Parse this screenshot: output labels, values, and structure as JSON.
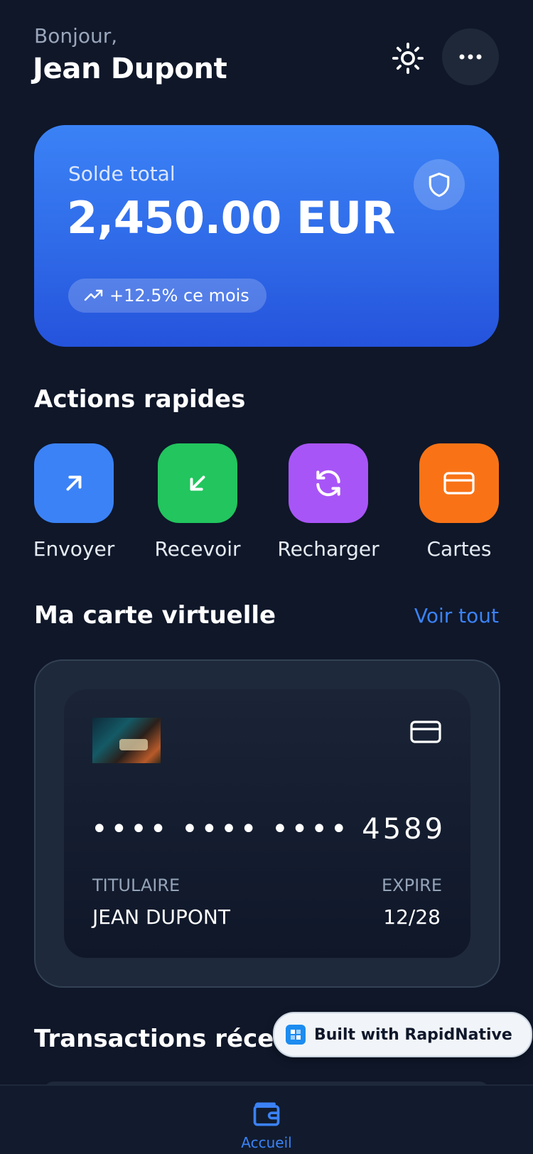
{
  "header": {
    "greeting": "Bonjour,",
    "user_name": "Jean Dupont"
  },
  "icons": {
    "theme": "sun-icon",
    "more": "more-horizontal-icon",
    "shield": "shield-icon",
    "trend": "trending-up-icon",
    "send": "arrow-up-right-icon",
    "receive": "arrow-down-left-icon",
    "reload": "refresh-icon",
    "cards": "credit-card-icon",
    "home": "wallet-icon"
  },
  "balance": {
    "label": "Solde total",
    "amount": "2,450.00 EUR",
    "trend": "+12.5% ce mois"
  },
  "quick_actions": {
    "title": "Actions rapides",
    "items": [
      {
        "label": "Envoyer",
        "color": "#3b82f6"
      },
      {
        "label": "Recevoir",
        "color": "#22c55e"
      },
      {
        "label": "Recharger",
        "color": "#a855f7"
      },
      {
        "label": "Cartes",
        "color": "#f97316"
      }
    ]
  },
  "virtual_card": {
    "title": "Ma carte virtuelle",
    "see_all": "Voir tout",
    "number": "•••• •••• •••• 4589",
    "holder_label": "TITULAIRE",
    "holder_value": "JEAN DUPONT",
    "expiry_label": "EXPIRE",
    "expiry_value": "12/28"
  },
  "transactions": {
    "title": "Transactions récen"
  },
  "badge": {
    "text": "Built with RapidNative"
  },
  "bottom_nav": {
    "home_label": "Accueil"
  },
  "colors": {
    "background": "#0f1729",
    "accent": "#3b82f6"
  }
}
